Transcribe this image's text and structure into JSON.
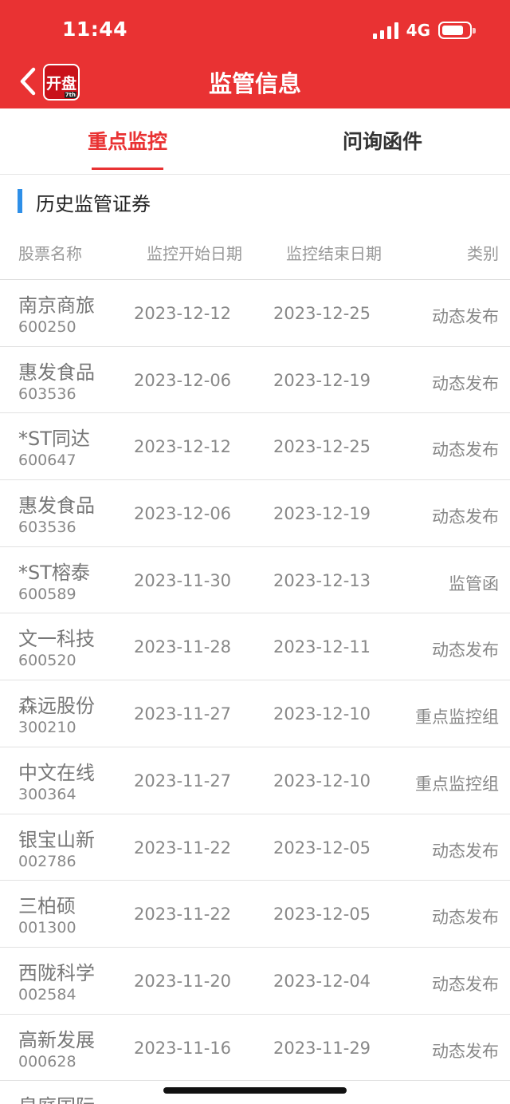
{
  "status_bar": {
    "time": "11:44",
    "network": "4G"
  },
  "header": {
    "title": "监管信息",
    "logo_text": "开盘",
    "logo_corner": "7th"
  },
  "tabs": [
    {
      "label": "重点监控",
      "active": true
    },
    {
      "label": "问询函件",
      "active": false
    }
  ],
  "section": {
    "title": "历史监管证券"
  },
  "columns": {
    "name": "股票名称",
    "start": "监控开始日期",
    "end": "监控结束日期",
    "type": "类别"
  },
  "rows": [
    {
      "name": "南京商旅",
      "code": "600250",
      "start": "2023-12-12",
      "end": "2023-12-25",
      "type": "动态发布"
    },
    {
      "name": "惠发食品",
      "code": "603536",
      "start": "2023-12-06",
      "end": "2023-12-19",
      "type": "动态发布"
    },
    {
      "name": "*ST同达",
      "code": "600647",
      "start": "2023-12-12",
      "end": "2023-12-25",
      "type": "动态发布"
    },
    {
      "name": "惠发食品",
      "code": "603536",
      "start": "2023-12-06",
      "end": "2023-12-19",
      "type": "动态发布"
    },
    {
      "name": "*ST榕泰",
      "code": "600589",
      "start": "2023-11-30",
      "end": "2023-12-13",
      "type": "监管函"
    },
    {
      "name": "文一科技",
      "code": "600520",
      "start": "2023-11-28",
      "end": "2023-12-11",
      "type": "动态发布"
    },
    {
      "name": "森远股份",
      "code": "300210",
      "start": "2023-11-27",
      "end": "2023-12-10",
      "type": "重点监控组"
    },
    {
      "name": "中文在线",
      "code": "300364",
      "start": "2023-11-27",
      "end": "2023-12-10",
      "type": "重点监控组"
    },
    {
      "name": "银宝山新",
      "code": "002786",
      "start": "2023-11-22",
      "end": "2023-12-05",
      "type": "动态发布"
    },
    {
      "name": "三柏硕",
      "code": "001300",
      "start": "2023-11-22",
      "end": "2023-12-05",
      "type": "动态发布"
    },
    {
      "name": "西陇科学",
      "code": "002584",
      "start": "2023-11-20",
      "end": "2023-12-04",
      "type": "动态发布"
    },
    {
      "name": "高新发展",
      "code": "000628",
      "start": "2023-11-16",
      "end": "2023-11-29",
      "type": "动态发布"
    },
    {
      "name": "皇庭国际",
      "code": "",
      "start": "",
      "end": "",
      "type": ""
    }
  ],
  "colors": {
    "brand_red": "#e93233",
    "accent_blue": "#2e8fe8"
  }
}
